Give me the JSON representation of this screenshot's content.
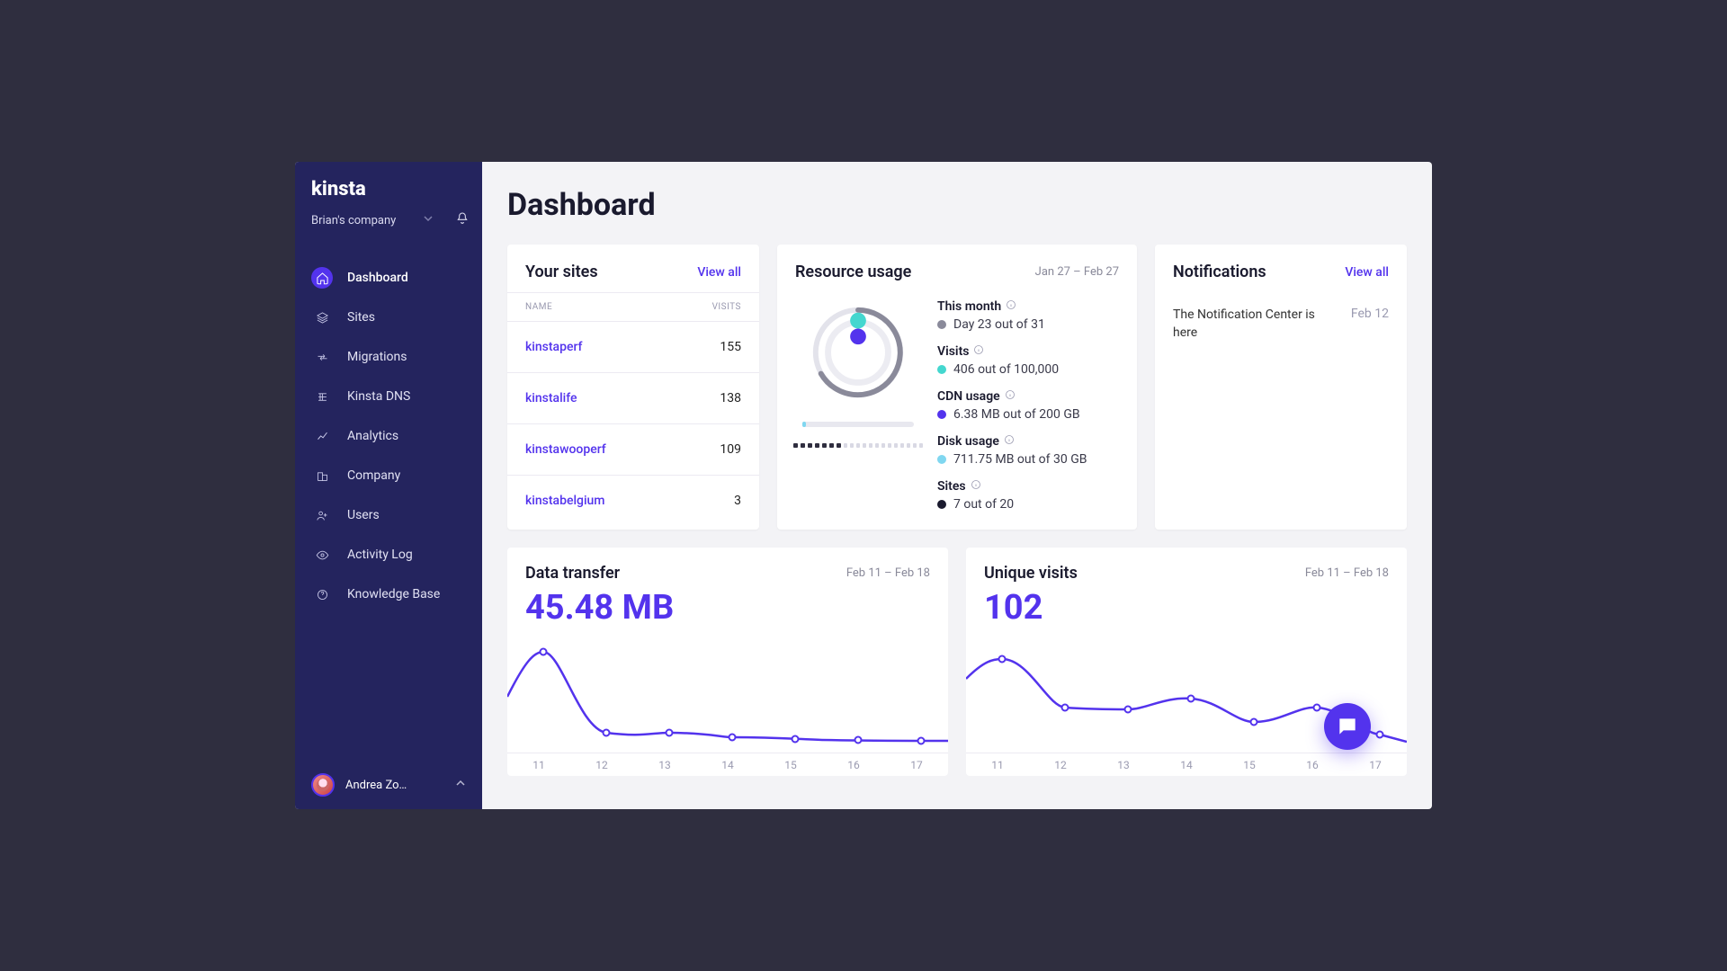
{
  "brand": "kinsta",
  "company": {
    "name": "Brian's company"
  },
  "nav": {
    "items": [
      {
        "label": "Dashboard",
        "icon": "home",
        "active": true
      },
      {
        "label": "Sites",
        "icon": "sites",
        "active": false
      },
      {
        "label": "Migrations",
        "icon": "migrations",
        "active": false
      },
      {
        "label": "Kinsta DNS",
        "icon": "dns",
        "active": false
      },
      {
        "label": "Analytics",
        "icon": "analytics",
        "active": false
      },
      {
        "label": "Company",
        "icon": "company",
        "active": false
      },
      {
        "label": "Users",
        "icon": "users",
        "active": false
      },
      {
        "label": "Activity Log",
        "icon": "activity",
        "active": false
      },
      {
        "label": "Knowledge Base",
        "icon": "help",
        "active": false
      }
    ]
  },
  "user": {
    "name": "Andrea Zo…"
  },
  "page": {
    "title": "Dashboard"
  },
  "sites": {
    "title": "Your sites",
    "view_all": "View all",
    "cols": {
      "name": "NAME",
      "visits": "VISITS"
    },
    "rows": [
      {
        "name": "kinstaperf",
        "visits": "155"
      },
      {
        "name": "kinstalife",
        "visits": "138"
      },
      {
        "name": "kinstawooperf",
        "visits": "109"
      },
      {
        "name": "kinstabelgium",
        "visits": "3"
      }
    ]
  },
  "resource": {
    "title": "Resource usage",
    "range": "Jan 27 – Feb 27",
    "metrics": {
      "month": {
        "label": "This month",
        "value": "Day 23 out of 31",
        "color": "#8a8a9a"
      },
      "visits": {
        "label": "Visits",
        "value": "406 out of 100,000",
        "color": "#44d7cf"
      },
      "cdn": {
        "label": "CDN usage",
        "value": "6.38 MB out of 200 GB",
        "color": "#5333ed"
      },
      "disk": {
        "label": "Disk usage",
        "value": "711.75 MB out of 30 GB",
        "color": "#80d7f0"
      },
      "sites": {
        "label": "Sites",
        "value": "7 out of 20",
        "color": "#1a1a2e"
      }
    }
  },
  "notifications": {
    "title": "Notifications",
    "view_all": "View all",
    "items": [
      {
        "title": "The Notification Center is here",
        "date": "Feb 12"
      }
    ]
  },
  "charts": {
    "transfer": {
      "title": "Data transfer",
      "range": "Feb 11 – Feb 18",
      "value": "45.48 MB"
    },
    "visits": {
      "title": "Unique visits",
      "range": "Feb 11 – Feb 18",
      "value": "102"
    }
  },
  "colors": {
    "accent": "#5333ed"
  },
  "chart_data": [
    {
      "type": "line",
      "name": "Data transfer",
      "title": "Data transfer",
      "x": [
        11,
        12,
        13,
        14,
        15,
        16,
        17
      ],
      "values": [
        15,
        4.2,
        3.8,
        3.7,
        3.6,
        3.5,
        3.5
      ],
      "unit": "MB",
      "xlabel": "",
      "ylabel": "",
      "ylim": [
        0,
        16
      ]
    },
    {
      "type": "line",
      "name": "Unique visits",
      "title": "Unique visits",
      "x": [
        11,
        12,
        13,
        14,
        15,
        16,
        17
      ],
      "values": [
        30,
        16,
        15,
        18,
        13,
        17,
        10
      ],
      "xlabel": "",
      "ylabel": "",
      "ylim": [
        0,
        35
      ]
    }
  ]
}
